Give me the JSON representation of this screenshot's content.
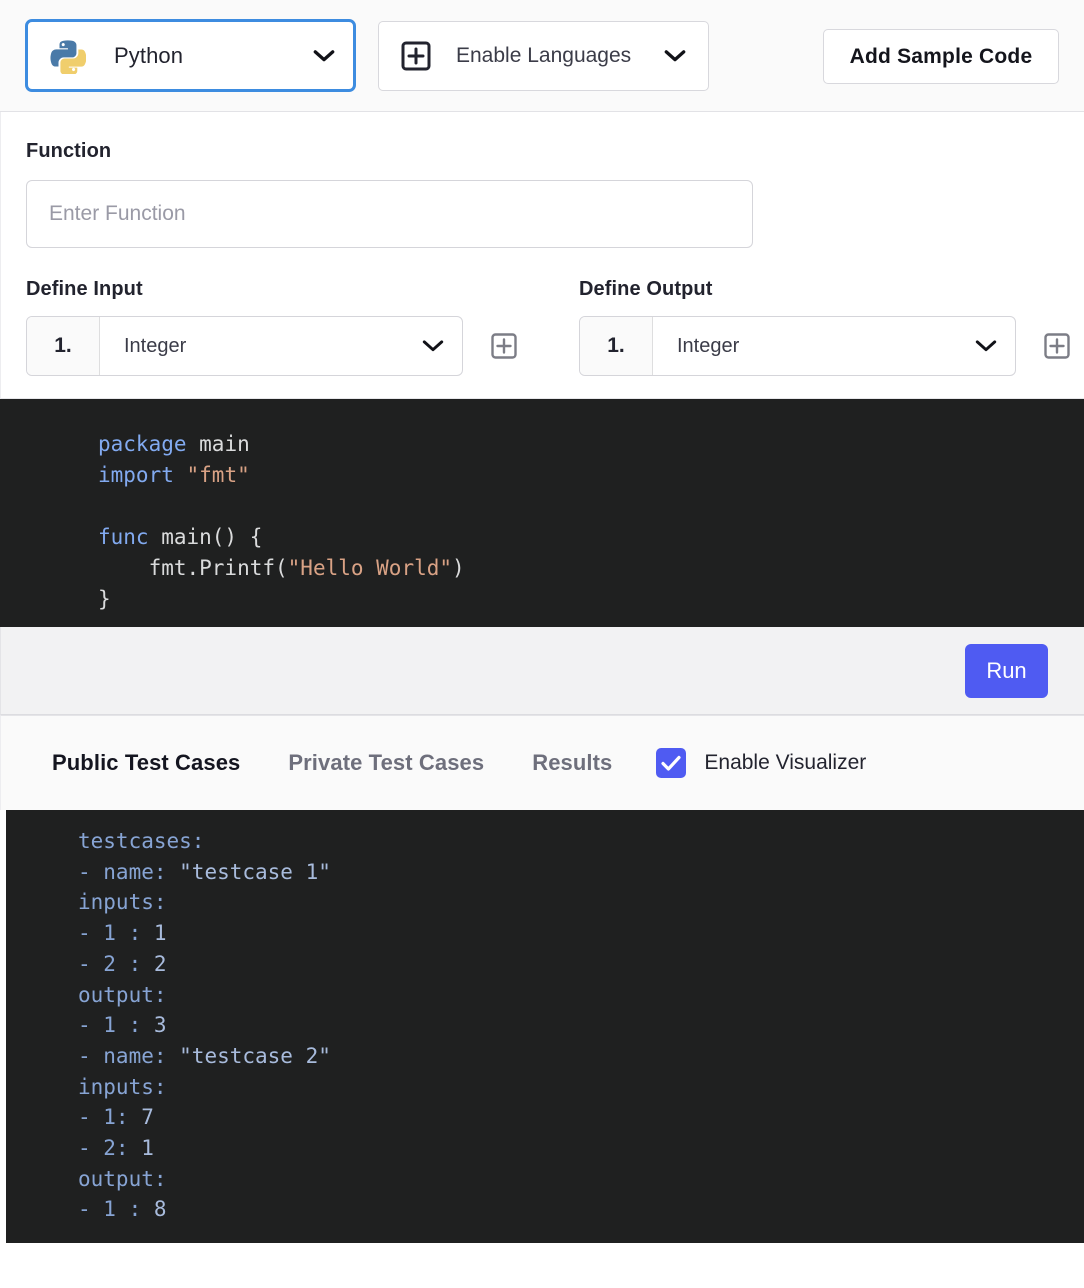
{
  "toolbar": {
    "language_select": {
      "value": "Python",
      "icon": "python-logo-icon",
      "chevron": "chevron-down-icon"
    },
    "enable_languages": {
      "label": "Enable Languages",
      "icon": "box-plus-icon",
      "chevron": "chevron-down-icon"
    },
    "add_sample_code_label": "Add Sample Code"
  },
  "form": {
    "function_label": "Function",
    "function_value": "",
    "function_placeholder": "Enter Function",
    "define_input_label": "Define Input",
    "define_output_label": "Define Output",
    "input_rows": [
      {
        "index": "1.",
        "type": "Integer"
      }
    ],
    "output_rows": [
      {
        "index": "1.",
        "type": "Integer"
      }
    ],
    "add_input_icon": "box-plus-icon",
    "add_output_icon": "box-plus-icon"
  },
  "code_editor": {
    "lines": [
      {
        "tokens": [
          {
            "t": "package ",
            "c": "kw"
          },
          {
            "t": "main",
            "c": "plain"
          }
        ]
      },
      {
        "tokens": [
          {
            "t": "import ",
            "c": "kw"
          },
          {
            "t": "\"fmt\"",
            "c": "str"
          }
        ]
      },
      {
        "tokens": [
          {
            "t": "",
            "c": "plain"
          }
        ]
      },
      {
        "tokens": [
          {
            "t": "func ",
            "c": "kw"
          },
          {
            "t": "main() {",
            "c": "plain"
          }
        ]
      },
      {
        "tokens": [
          {
            "t": "    fmt.Printf(",
            "c": "plain"
          },
          {
            "t": "\"Hello World\"",
            "c": "str"
          },
          {
            "t": ")",
            "c": "plain"
          }
        ]
      },
      {
        "tokens": [
          {
            "t": "}",
            "c": "plain"
          }
        ]
      }
    ],
    "plain_text": "package main\nimport \"fmt\"\n\nfunc main() {\n    fmt.Printf(\"Hello World\")\n}"
  },
  "run_bar": {
    "run_label": "Run"
  },
  "tabs": [
    {
      "label": "Public Test Cases",
      "active": true
    },
    {
      "label": "Private Test Cases",
      "active": false
    },
    {
      "label": "Results",
      "active": false
    }
  ],
  "visualizer": {
    "label": "Enable Visualizer",
    "checked": true,
    "check_icon": "checkmark-icon"
  },
  "testcase_editor": {
    "lines": [
      "testcases:",
      "- name: \"testcase 1\"",
      "inputs:",
      "- 1 : 1",
      "- 2 : 2",
      "output:",
      "- 1 : 3",
      "- name: \"testcase 2\"",
      "inputs:",
      "- 1: 7",
      "- 2: 1",
      "output:",
      "- 1 : 8"
    ],
    "testcases": [
      {
        "name": "testcase 1",
        "inputs": [
          {
            "key": "1",
            "value": "1"
          },
          {
            "key": "2",
            "value": "2"
          }
        ],
        "output": [
          {
            "key": "1",
            "value": "3"
          }
        ]
      },
      {
        "name": "testcase 2",
        "inputs": [
          {
            "key": "1",
            "value": "7"
          },
          {
            "key": "2",
            "value": "1"
          }
        ],
        "output": [
          {
            "key": "1",
            "value": "8"
          }
        ]
      }
    ]
  },
  "colors": {
    "accent": "#4f5bf2",
    "focus_border": "#3d8ce0",
    "editor_bg": "#1f2020",
    "keyword": "#82aaf0",
    "string": "#d9a285",
    "yaml_key": "#87a4d4"
  }
}
